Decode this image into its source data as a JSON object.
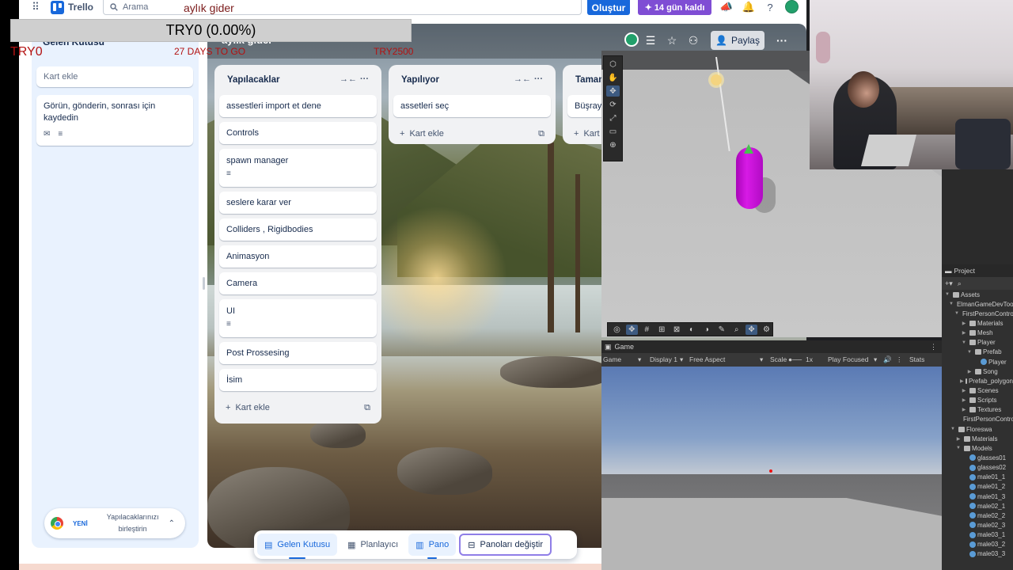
{
  "trello": {
    "brand": "Trello",
    "search_placeholder": "Arama",
    "create_label": "Oluştur",
    "trial_label": "14 gün kaldı",
    "inbox": {
      "title": "Gelen Kutusu",
      "add_card_placeholder": "Kart ekle",
      "card_text": "Görün, gönderin, sonrası için kaydedin",
      "merge_new": "YENİ",
      "merge_text": "Yapılacaklarınızı birleştirin"
    },
    "board": {
      "title": "aylık gider",
      "share_label": "Paylaş",
      "lists": [
        {
          "title": "Yapılacaklar",
          "cards": [
            "assestleri import et dene",
            "Controls",
            "spawn manager",
            "seslere karar ver",
            "Colliders , Rigidbodies",
            "Animasyon",
            "Camera",
            "UI",
            "Post Prossesing",
            "İsim"
          ],
          "add_label": "Kart ekle"
        },
        {
          "title": "Yapılıyor",
          "cards": [
            "assetleri seç"
          ],
          "add_label": "Kart ekle"
        },
        {
          "title": "Tamamlandı",
          "cards": [
            "Büşray"
          ],
          "add_label": "Kart ekle"
        }
      ]
    },
    "bottom_nav": {
      "inbox": "Gelen Kutusu",
      "planner": "Planlayıcı",
      "board": "Pano",
      "switch": "Panoları değiştir"
    }
  },
  "overlay": {
    "title": "aylık gider",
    "balance_bar": "TRY0 (0.00%)",
    "current": "TRY0",
    "days": "27 DAYS TO GO",
    "goal": "TRY2500"
  },
  "unity": {
    "game_tab": "Game",
    "game_display_mode": "Game",
    "display": "Display 1",
    "aspect": "Free Aspect",
    "scale_label": "Scale",
    "scale_value": "1x",
    "play_mode": "Play Focused",
    "stats": "Stats",
    "project_tab": "Project",
    "tree": [
      {
        "label": "Assets",
        "depth": 0,
        "kind": "folder",
        "open": true
      },
      {
        "label": "ElmanGameDevTools",
        "depth": 1,
        "kind": "folder",
        "open": true
      },
      {
        "label": "FirstPersonController",
        "depth": 2,
        "kind": "folder",
        "open": true
      },
      {
        "label": "Materials",
        "depth": 3,
        "kind": "folder"
      },
      {
        "label": "Mesh",
        "depth": 3,
        "kind": "folder"
      },
      {
        "label": "Player",
        "depth": 3,
        "kind": "folder",
        "open": true
      },
      {
        "label": "Prefab",
        "depth": 4,
        "kind": "folder",
        "open": true
      },
      {
        "label": "Player",
        "depth": 5,
        "kind": "prefab"
      },
      {
        "label": "Song",
        "depth": 4,
        "kind": "folder"
      },
      {
        "label": "Prefab_polygon",
        "depth": 3,
        "kind": "folder"
      },
      {
        "label": "Scenes",
        "depth": 3,
        "kind": "folder"
      },
      {
        "label": "Scripts",
        "depth": 3,
        "kind": "folder"
      },
      {
        "label": "Textures",
        "depth": 3,
        "kind": "folder"
      },
      {
        "label": "FirstPersonController",
        "depth": 3,
        "kind": "asset"
      },
      {
        "label": "Floreswa",
        "depth": 1,
        "kind": "folder",
        "open": true
      },
      {
        "label": "Materials",
        "depth": 2,
        "kind": "folder"
      },
      {
        "label": "Models",
        "depth": 2,
        "kind": "folder",
        "open": true
      },
      {
        "label": "glasses01",
        "depth": 3,
        "kind": "model"
      },
      {
        "label": "glasses02",
        "depth": 3,
        "kind": "model"
      },
      {
        "label": "male01_1",
        "depth": 3,
        "kind": "model"
      },
      {
        "label": "male01_2",
        "depth": 3,
        "kind": "model"
      },
      {
        "label": "male01_3",
        "depth": 3,
        "kind": "model"
      },
      {
        "label": "male02_1",
        "depth": 3,
        "kind": "model"
      },
      {
        "label": "male02_2",
        "depth": 3,
        "kind": "model"
      },
      {
        "label": "male02_3",
        "depth": 3,
        "kind": "model"
      },
      {
        "label": "male03_1",
        "depth": 3,
        "kind": "model"
      },
      {
        "label": "male03_2",
        "depth": 3,
        "kind": "model"
      },
      {
        "label": "male03_3",
        "depth": 3,
        "kind": "model"
      }
    ]
  },
  "colors": {
    "trello_blue": "#1868db",
    "trial_purple": "#7f4dd4",
    "overlay_red": "#b31212",
    "capsule_magenta": "#d81ae6"
  }
}
